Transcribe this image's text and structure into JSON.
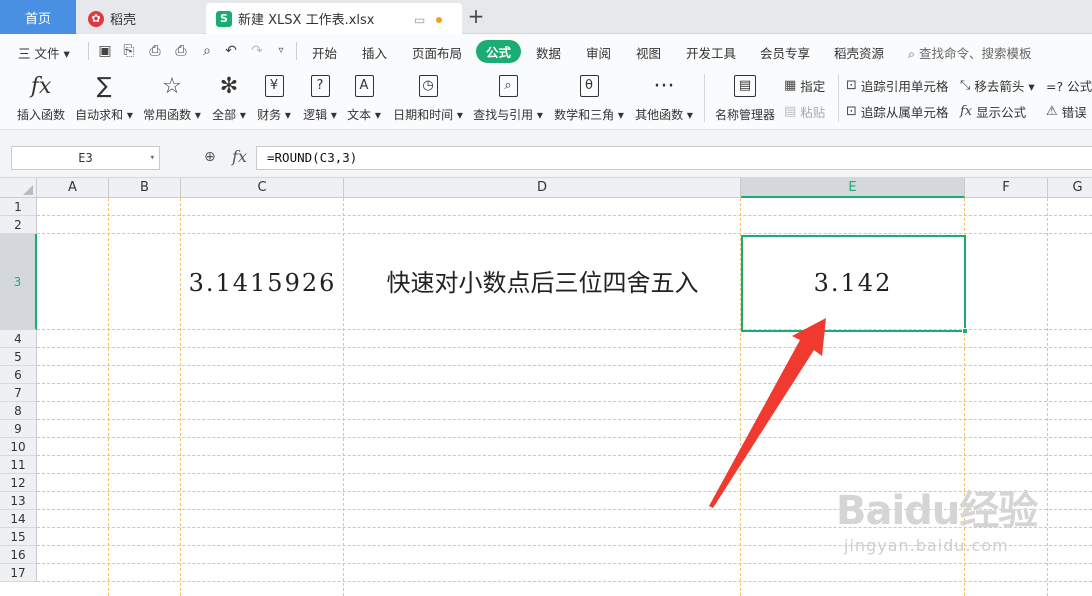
{
  "tabs": {
    "home": "首页",
    "daoke": "稻壳",
    "file": "新建 XLSX 工作表.xlsx",
    "new_tab": "+"
  },
  "menu": {
    "file": "三 文件",
    "items": [
      "开始",
      "插入",
      "页面布局",
      "公式",
      "数据",
      "审阅",
      "视图",
      "开发工具",
      "会员专享",
      "稻壳资源"
    ],
    "active": "公式",
    "search": "查找命令、搜索模板"
  },
  "ribbon": {
    "buttons": [
      {
        "icon": "fx-icon",
        "glyph": "fx",
        "label": "插入函数"
      },
      {
        "icon": "sigma-icon",
        "glyph": "∑",
        "label": "自动求和 ▾"
      },
      {
        "icon": "star-icon",
        "glyph": "☆",
        "label": "常用函数 ▾"
      },
      {
        "icon": "asterisk-icon",
        "glyph": "✻",
        "label": "全部 ▾"
      },
      {
        "icon": "yen-icon",
        "glyph": "¥",
        "label": "财务 ▾"
      },
      {
        "icon": "question-icon",
        "glyph": "?",
        "label": "逻辑 ▾"
      },
      {
        "icon": "text-a-icon",
        "glyph": "A",
        "label": "文本 ▾"
      },
      {
        "icon": "clock-icon",
        "glyph": "◷",
        "label": "日期和时间 ▾"
      },
      {
        "icon": "search-doc-icon",
        "glyph": "⌕",
        "label": "查找与引用 ▾"
      },
      {
        "icon": "theta-icon",
        "glyph": "θ",
        "label": "数学和三角 ▾"
      },
      {
        "icon": "more-dots-icon",
        "glyph": "···",
        "label": "其他函数 ▾"
      },
      {
        "icon": "name-manager-icon",
        "glyph": "▤",
        "label": "名称管理器"
      }
    ],
    "small": {
      "specify": "指定",
      "paste": "粘贴",
      "trace_precedents": "追踪引用单元格",
      "trace_dependents": "追踪从属单元格",
      "remove_arrows": "移去箭头 ▾",
      "show_formulas": "显示公式",
      "formula_audit": "=? 公式",
      "error_check": "错误"
    }
  },
  "formula_bar": {
    "name_box": "E3",
    "fx": "fx",
    "formula": "=ROUND(C3,3)"
  },
  "grid": {
    "columns": [
      "A",
      "B",
      "C",
      "D",
      "E",
      "F",
      "G"
    ],
    "selected_column": "E",
    "rows": [
      "1",
      "2",
      "3",
      "4",
      "5",
      "6",
      "7",
      "8",
      "9",
      "10",
      "11",
      "12",
      "13",
      "14",
      "15",
      "16",
      "17"
    ],
    "selected_row": "3",
    "cells": {
      "C3": "3.1415926",
      "D3": "快速对小数点后三位四舍五入",
      "E3": "3.142"
    },
    "annotation_color": "#f0392f",
    "accent_color": "#1aad73"
  },
  "watermark": {
    "logo": "Baidu经验",
    "url": "jingyan.baidu.com"
  }
}
